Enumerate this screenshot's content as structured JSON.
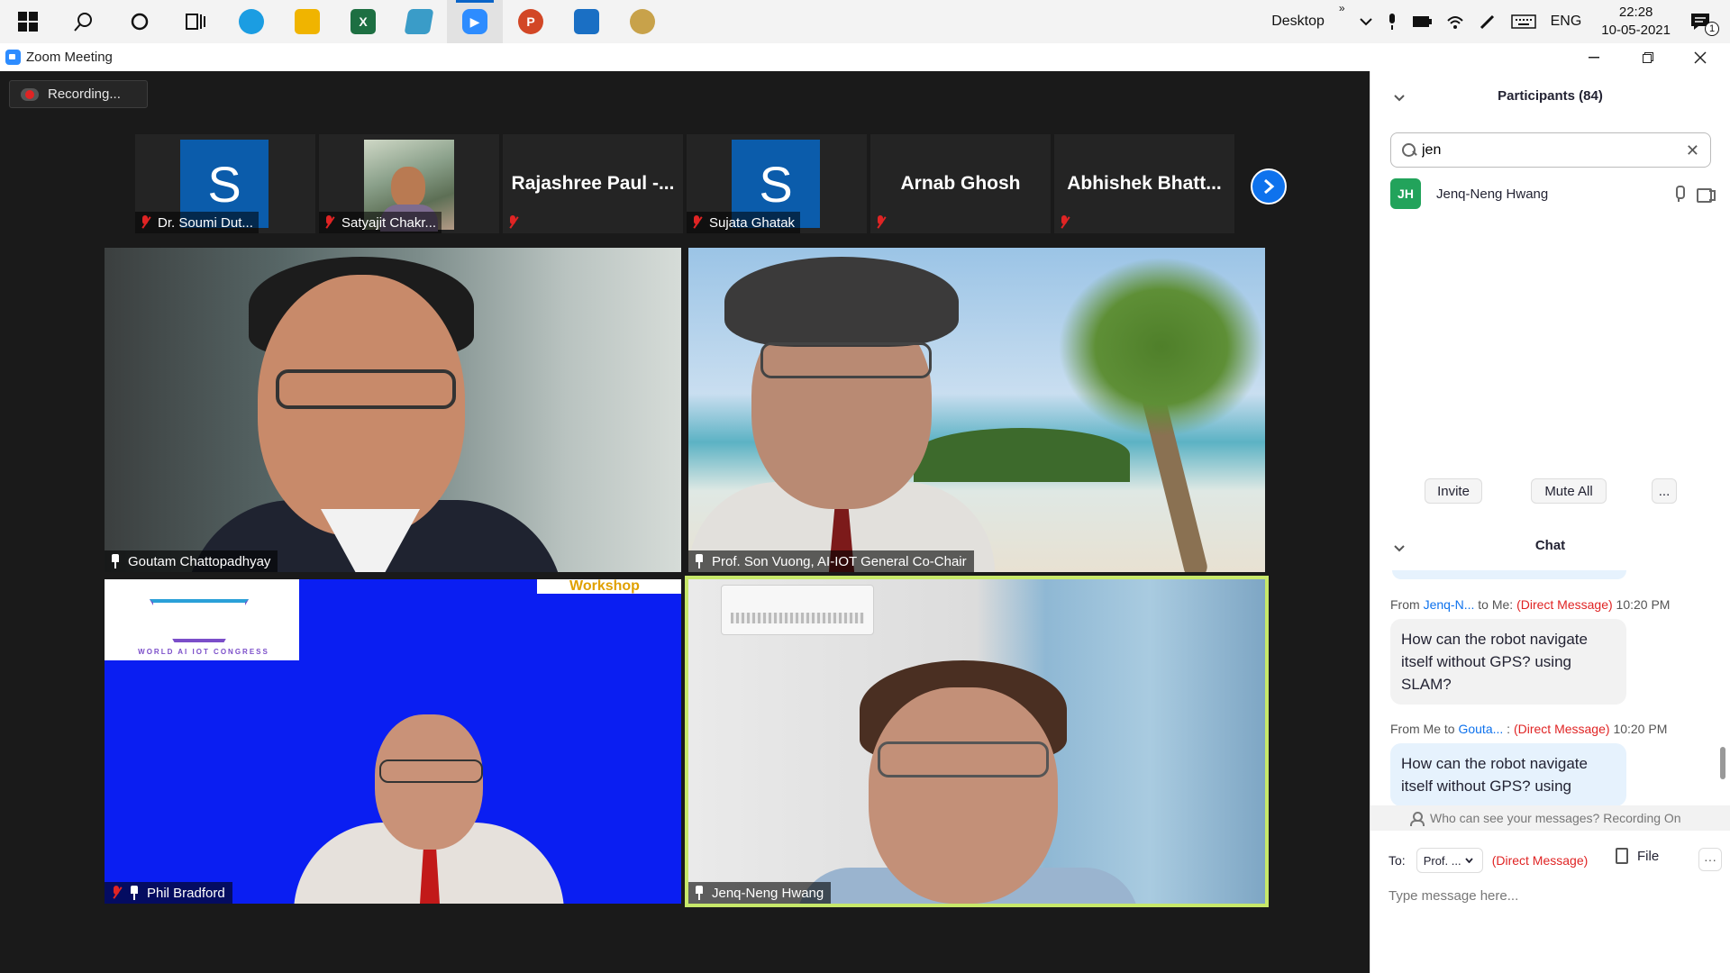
{
  "taskbar": {
    "apps": [
      {
        "icon": "windows-start-icon"
      },
      {
        "icon": "search-icon"
      },
      {
        "icon": "cortana-icon"
      },
      {
        "icon": "task-view-icon"
      },
      {
        "icon": "edge-icon",
        "color": "#1b9de2"
      },
      {
        "icon": "file-explorer-icon",
        "color": "#f0b400"
      },
      {
        "icon": "excel-icon",
        "color": "#1d6f42"
      },
      {
        "icon": "app-icon",
        "color": "#3a9cc8"
      },
      {
        "icon": "zoom-icon",
        "color": "#2d8cff"
      },
      {
        "icon": "powerpoint-icon",
        "color": "#d24726"
      },
      {
        "icon": "photos-icon",
        "color": "#1a6fc4"
      },
      {
        "icon": "paint-icon",
        "color": "#c8a24a"
      }
    ],
    "tray": {
      "desktop_label": "Desktop",
      "chevron_glyph": "»",
      "language": "ENG",
      "time": "22:28",
      "date": "10-05-2021",
      "notification_count": "1"
    }
  },
  "window": {
    "title": "Zoom Meeting"
  },
  "meeting": {
    "recording_label": "Recording...",
    "thumbnails": [
      {
        "name": "Dr. Soumi Dut...",
        "avatar_letter": "S",
        "type": "avatar"
      },
      {
        "name": "Satyajit Chakr...",
        "type": "photo"
      },
      {
        "display_name": "Rajashree  Paul  -...",
        "type": "name"
      },
      {
        "name": "Sujata Ghatak",
        "avatar_letter": "S",
        "type": "avatar"
      },
      {
        "display_name": "Arnab Ghosh",
        "type": "name"
      },
      {
        "display_name": "Abhishek  Bhatt...",
        "type": "name"
      }
    ],
    "tiles": [
      {
        "name": "Goutam Chattopadhyay"
      },
      {
        "name": "Prof. Son Vuong, AI-IOT General Co-Chair"
      },
      {
        "name": "Phil Bradford",
        "logo_text": "WORLD AI IOT CONGRESS",
        "banner_text": "Workshop"
      },
      {
        "name": "Jenq-Neng Hwang"
      }
    ]
  },
  "participants": {
    "title": "Participants (84)",
    "search_value": "jen",
    "list": [
      {
        "initials": "JH",
        "name": "Jenq-Neng Hwang",
        "avatar_color": "#22a35b"
      }
    ],
    "buttons": {
      "invite": "Invite",
      "mute_all": "Mute All",
      "more": "..."
    }
  },
  "chat": {
    "title": "Chat",
    "messages": [
      {
        "from_prefix": "From",
        "from": "Jenq-N...",
        "to_text": "to Me:",
        "direct": "(Direct Message)",
        "time": "10:20 PM",
        "text": "How can the robot navigate itself without GPS? using SLAM?",
        "direction": "in"
      },
      {
        "from_prefix": "From Me to",
        "from": "Gouta...",
        "to_text": ":",
        "direct": "(Direct Message)",
        "time": "10:20 PM",
        "text": "How can the robot navigate itself without GPS? using",
        "direction": "out"
      }
    ],
    "privacy_text": "Who can see your messages? Recording On",
    "to_label": "To:",
    "to_value": "Prof. ...",
    "to_direct": "(Direct Message)",
    "file_label": "File",
    "more_label": "···",
    "input_placeholder": "Type message here..."
  }
}
